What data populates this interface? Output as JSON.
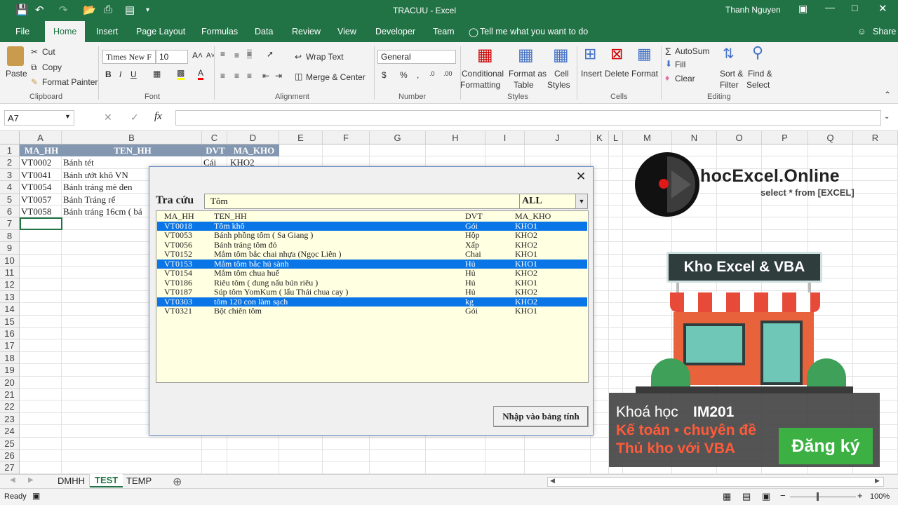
{
  "window": {
    "title": "TRACUU  -  Excel",
    "user": "Thanh Nguyen"
  },
  "tabs": [
    "File",
    "Home",
    "Insert",
    "Page Layout",
    "Formulas",
    "Data",
    "Review",
    "View",
    "Developer",
    "Team"
  ],
  "tell_me": "Tell me what you want to do",
  "share": "Share",
  "ribbon": {
    "clipboard": {
      "paste": "Paste",
      "cut": "Cut",
      "copy": "Copy",
      "format_painter": "Format Painter",
      "label": "Clipboard"
    },
    "font": {
      "name": "Times New F",
      "size": "10",
      "label": "Font"
    },
    "alignment": {
      "wrap": "Wrap Text",
      "merge": "Merge & Center",
      "label": "Alignment"
    },
    "number": {
      "format": "General",
      "label": "Number"
    },
    "styles": {
      "cond1": "Conditional",
      "cond2": "Formatting",
      "fmt1": "Format as",
      "fmt2": "Table",
      "cell1": "Cell",
      "cell2": "Styles",
      "label": "Styles"
    },
    "cells": {
      "insert": "Insert",
      "delete": "Delete",
      "format": "Format",
      "label": "Cells"
    },
    "editing": {
      "autosum": "AutoSum",
      "fill": "Fill",
      "clear": "Clear",
      "sort1": "Sort &",
      "sort2": "Filter",
      "find1": "Find &",
      "find2": "Select",
      "label": "Editing"
    }
  },
  "namebox": "A7",
  "fx": "fx",
  "columns": [
    "A",
    "B",
    "C",
    "D",
    "E",
    "F",
    "G",
    "H",
    "I",
    "J",
    "K",
    "L",
    "M",
    "N",
    "O",
    "P",
    "Q",
    "R"
  ],
  "rows": [
    "1",
    "2",
    "3",
    "4",
    "5",
    "6",
    "7",
    "8",
    "9",
    "10",
    "11",
    "12",
    "13",
    "14",
    "15",
    "16",
    "17",
    "18",
    "19",
    "20",
    "21",
    "22",
    "23",
    "24",
    "25",
    "26",
    "27"
  ],
  "sheet": {
    "headers": [
      "MA_HH",
      "TEN_HH",
      "DVT",
      "MA_KHO"
    ],
    "data": [
      [
        "VT0002",
        "Bánh tét",
        "Cái",
        "KHO2"
      ],
      [
        "VT0041",
        "Bánh ướt khô VN",
        "",
        ""
      ],
      [
        "VT0054",
        "Bánh tráng mè đen",
        "",
        ""
      ],
      [
        "VT0057",
        "Bánh Tráng rế",
        "",
        ""
      ],
      [
        "VT0058",
        "Bánh tráng 16cm  ( bá",
        "",
        ""
      ]
    ]
  },
  "dialog": {
    "label": "Tra cứu",
    "search_value": "Tôm",
    "filter_value": "ALL",
    "button": "Nhập vào bảng tính",
    "list_headers": [
      "MA_HH",
      "TEN_HH",
      "DVT",
      "MA_KHO"
    ],
    "list_rows": [
      {
        "c": [
          "VT0018",
          "Tôm khô",
          "Gói",
          "KHO1"
        ],
        "sel": true
      },
      {
        "c": [
          "VT0053",
          "Bánh phồng tôm ( Sa Giang )",
          "Hộp",
          "KHO2"
        ],
        "sel": false
      },
      {
        "c": [
          "VT0056",
          "Bánh tráng tôm đỏ",
          "Xấp",
          "KHO2"
        ],
        "sel": false
      },
      {
        "c": [
          "VT0152",
          "Mắm tôm bắc chai nhựa (Ngọc Liên )",
          "Chai",
          "KHO1"
        ],
        "sel": false
      },
      {
        "c": [
          "VT0153",
          "Mắm tôm bắc hủ sành",
          "Hủ",
          "KHO1"
        ],
        "sel": true
      },
      {
        "c": [
          "VT0154",
          "Mắm tôm chua huế",
          "Hủ",
          "KHO2"
        ],
        "sel": false
      },
      {
        "c": [
          "VT0186",
          "Riêu tôm ( dung nấu bún riêu )",
          "Hủ",
          "KHO1"
        ],
        "sel": false
      },
      {
        "c": [
          "VT0187",
          "Súp tôm YomKum ( lẩu Thái chua cay )",
          "Hủ",
          "KHO2"
        ],
        "sel": false
      },
      {
        "c": [
          "VT0303",
          "tôm 120 con làm sạch",
          "kg",
          "KHO2"
        ],
        "sel": true
      },
      {
        "c": [
          "VT0321",
          "Bột chiên tôm",
          "Gói",
          "KHO1"
        ],
        "sel": false
      }
    ]
  },
  "brand": {
    "logo": "hocExcel.Online",
    "slogan": "select * from [EXCEL]",
    "store_sign": "Kho Excel & VBA"
  },
  "promo": {
    "line1_prefix": "Khoá học",
    "line1_code": "IM201",
    "line2": "Kế toán • chuyên đề",
    "line3": "Thủ kho với VBA",
    "cta": "Đăng ký"
  },
  "sheet_tabs": [
    "DMHH",
    "TEST",
    "TEMP"
  ],
  "active_sheet": "TEST",
  "status": {
    "ready": "Ready",
    "zoom": "100%"
  },
  "colors": {
    "excel_green": "#217346",
    "header_fill": "#8497b0",
    "list_bg": "#ffffe1",
    "selection": "#0a75e6",
    "promo_red": "#ff5b3a",
    "cta_green": "#3cb043"
  }
}
